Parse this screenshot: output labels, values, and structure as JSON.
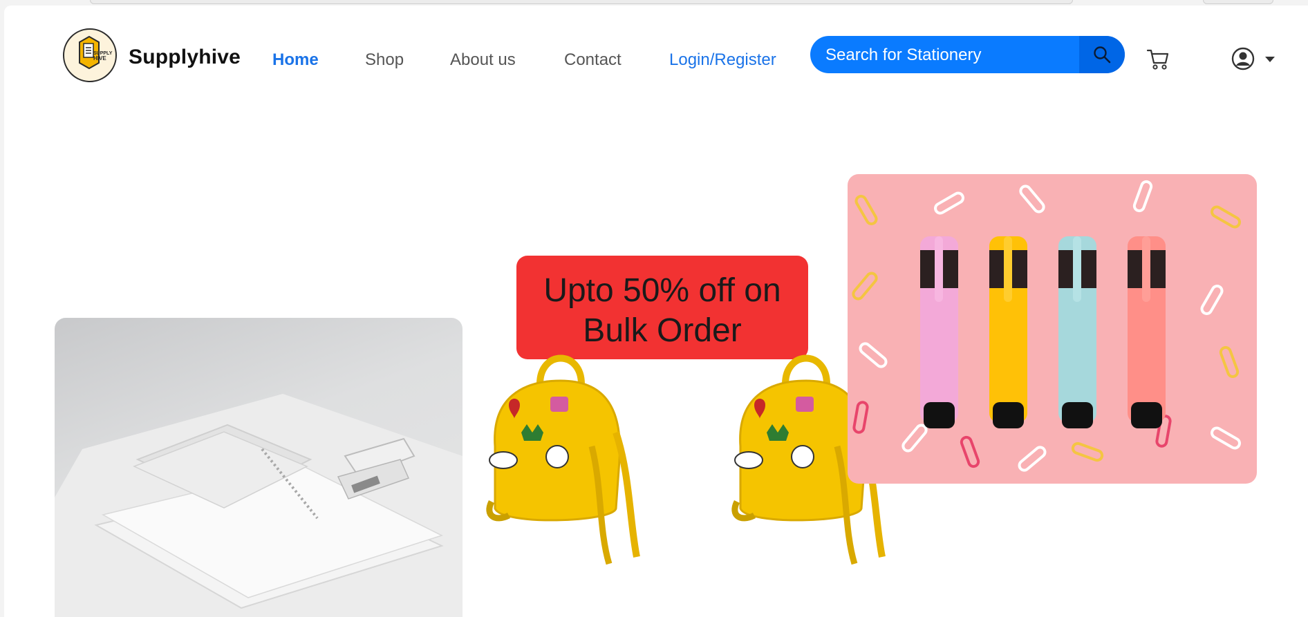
{
  "brand": {
    "name": "Supplyhive",
    "logo_text_line1": "SUPPLY",
    "logo_text_line2": "HIVE"
  },
  "nav": {
    "home": "Home",
    "shop": "Shop",
    "about": "About us",
    "contact": "Contact",
    "login": "Login/Register"
  },
  "search": {
    "placeholder": "Search for Stationery",
    "icon": "search-icon"
  },
  "header_icons": {
    "cart": "cart-icon",
    "user": "user-circle-icon",
    "dropdown": "caret-down-icon"
  },
  "hero": {
    "promo_line1": "Upto 50% off on",
    "promo_line2": "Bulk Order",
    "left_image": "notebooks-and-stapler-photo",
    "right_image": "highlighters-and-paperclips-photo",
    "backpack_image": "yellow-backpack-image"
  },
  "colors": {
    "accent": "#1a73e8",
    "search_bg": "#0a7bff",
    "promo_bg": "#f23232",
    "right_photo_bg": "#f9b1b4"
  }
}
